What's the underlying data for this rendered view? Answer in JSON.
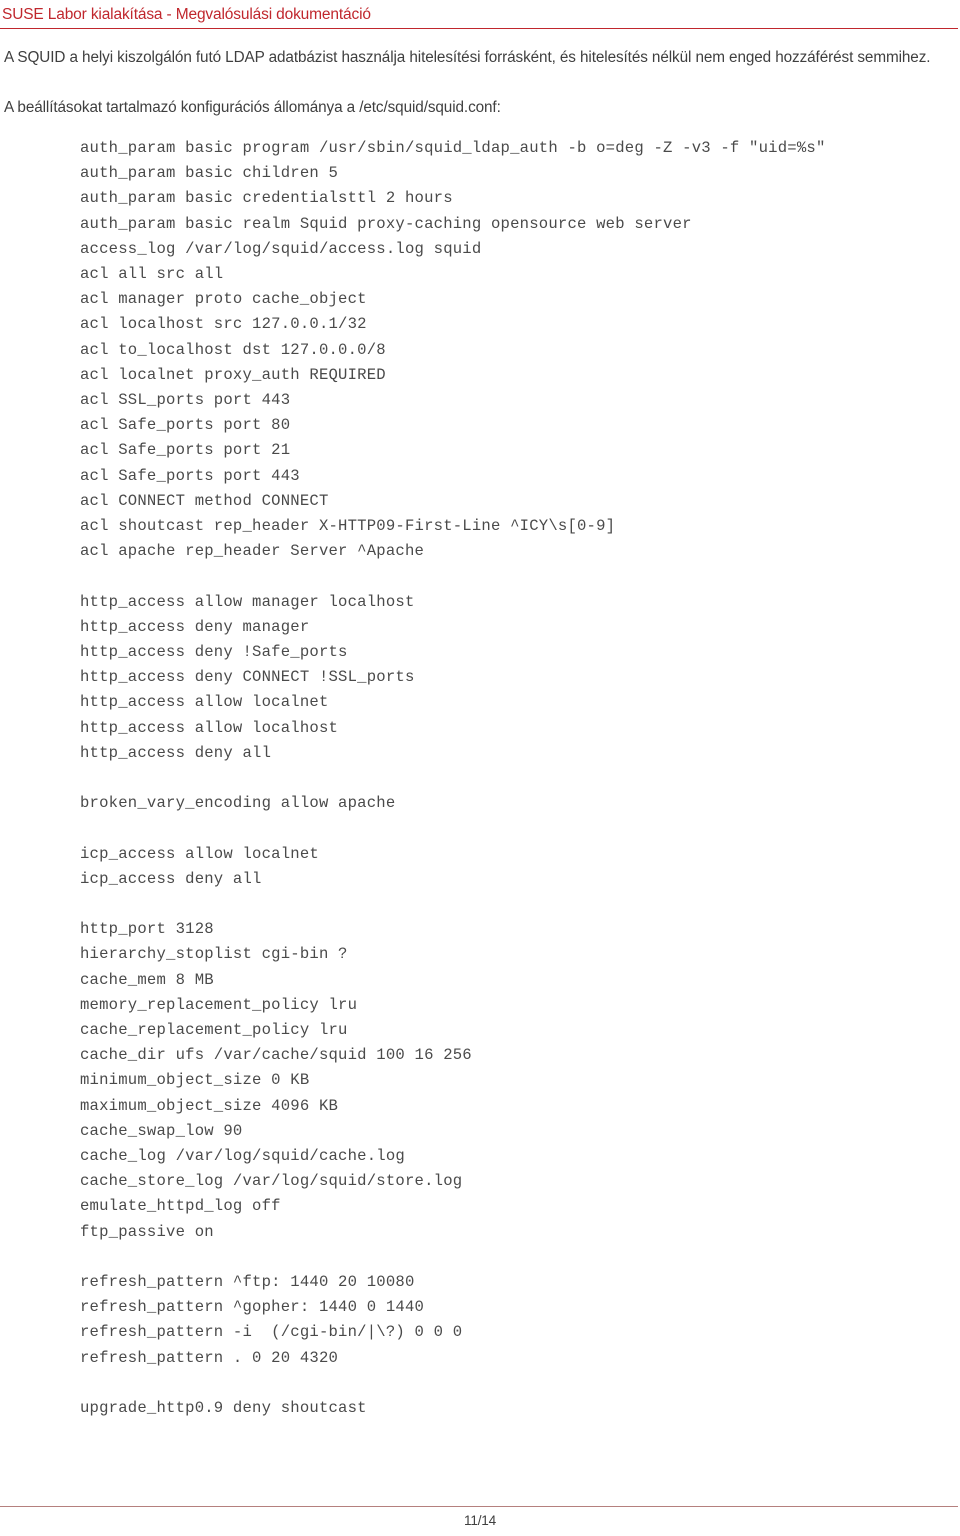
{
  "header": {
    "title": "SUSE Labor kialakítása - Megvalósulási dokumentáció",
    "rule_color": "#c0272d"
  },
  "content": {
    "paragraph_1": "A SQUID a helyi kiszolgálón futó LDAP adatbázist használja hitelesítési forrásként, és hitelesítés nélkül nem enged hozzáférést semmihez.",
    "paragraph_2": "A beállításokat tartalmazó konfigurációs állománya a /etc/squid/squid.conf:",
    "config_file_path": "/etc/squid/squid.conf",
    "code_lines": [
      "auth_param basic program /usr/sbin/squid_ldap_auth -b o=deg -Z -v3 -f \"uid=%s\"",
      "auth_param basic children 5",
      "auth_param basic credentialsttl 2 hours",
      "auth_param basic realm Squid proxy-caching opensource web server",
      "access_log /var/log/squid/access.log squid",
      "acl all src all",
      "acl manager proto cache_object",
      "acl localhost src 127.0.0.1/32",
      "acl to_localhost dst 127.0.0.0/8",
      "acl localnet proxy_auth REQUIRED",
      "acl SSL_ports port 443",
      "acl Safe_ports port 80",
      "acl Safe_ports port 21",
      "acl Safe_ports port 443",
      "acl CONNECT method CONNECT",
      "acl shoutcast rep_header X-HTTP09-First-Line ^ICY\\s[0-9]",
      "acl apache rep_header Server ^Apache",
      "",
      "http_access allow manager localhost",
      "http_access deny manager",
      "http_access deny !Safe_ports",
      "http_access deny CONNECT !SSL_ports",
      "http_access allow localnet",
      "http_access allow localhost",
      "http_access deny all",
      "",
      "broken_vary_encoding allow apache",
      "",
      "icp_access allow localnet",
      "icp_access deny all",
      "",
      "http_port 3128",
      "hierarchy_stoplist cgi-bin ?",
      "cache_mem 8 MB",
      "memory_replacement_policy lru",
      "cache_replacement_policy lru",
      "cache_dir ufs /var/cache/squid 100 16 256",
      "minimum_object_size 0 KB",
      "maximum_object_size 4096 KB",
      "cache_swap_low 90",
      "cache_log /var/log/squid/cache.log",
      "cache_store_log /var/log/squid/store.log",
      "emulate_httpd_log off",
      "ftp_passive on",
      "",
      "refresh_pattern ^ftp: 1440 20 10080",
      "refresh_pattern ^gopher: 1440 0 1440",
      "refresh_pattern -i  (/cgi-bin/|\\?) 0 0 0",
      "refresh_pattern . 0 20 4320",
      "",
      "upgrade_http0.9 deny shoutcast"
    ]
  },
  "footer": {
    "page_number": "11/14",
    "rule_color": "#b5807e"
  }
}
